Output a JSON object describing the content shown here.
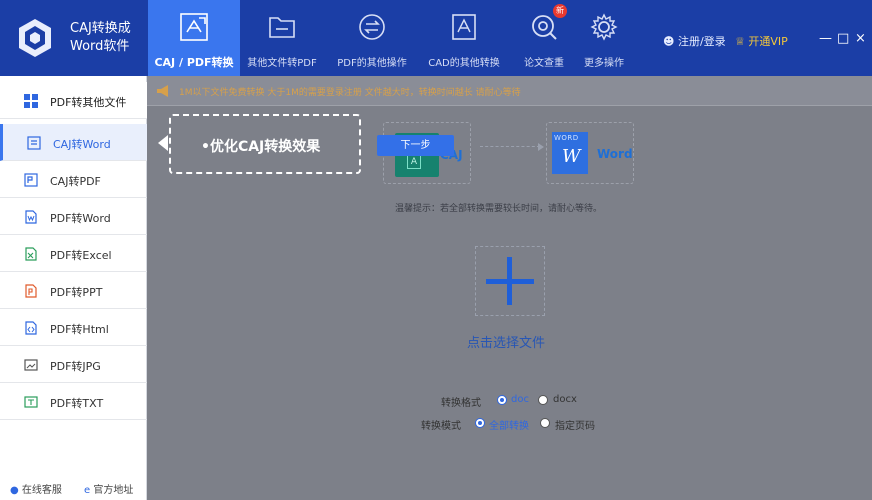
{
  "app": {
    "title_line1": "CAJ转换成",
    "title_line2": "Word软件"
  },
  "tabs": [
    {
      "label": "CAJ / PDF转换",
      "icon": "caj-pdf-convert-icon",
      "active": true
    },
    {
      "label": "其他文件转PDF",
      "icon": "folder-icon"
    },
    {
      "label": "PDF的其他操作",
      "icon": "swap-arrows-icon"
    },
    {
      "label": "CAD的其他转换",
      "icon": "cad-drawing-icon"
    },
    {
      "label": "论文查重",
      "icon": "search-check-icon",
      "badge": "新"
    },
    {
      "label": "更多操作",
      "icon": "gear-icon"
    }
  ],
  "header_right": {
    "login": "注册/登录",
    "vip": "开通VIP"
  },
  "window_controls": {
    "minimize": "—",
    "maximize": "□",
    "close": "×"
  },
  "sidebar": {
    "items": [
      {
        "label": "PDF转其他文件",
        "icon": "grid-icon"
      },
      {
        "label": "CAJ转Word",
        "icon": "caj-word-icon"
      },
      {
        "label": "CAJ转PDF",
        "icon": "caj-pdf-icon"
      },
      {
        "label": "PDF转Word",
        "icon": "pdf-word-icon"
      },
      {
        "label": "PDF转Excel",
        "icon": "pdf-excel-icon"
      },
      {
        "label": "PDF转PPT",
        "icon": "pdf-ppt-icon"
      },
      {
        "label": "PDF转Html",
        "icon": "pdf-html-icon"
      },
      {
        "label": "PDF转JPG",
        "icon": "pdf-jpg-icon"
      },
      {
        "label": "PDF转TXT",
        "icon": "pdf-txt-icon"
      }
    ],
    "support": "在线客服",
    "website": "官方地址"
  },
  "notice": {
    "text": "1M以下文件免费转换    大于1M的需要登录注册    文件越大时，转换时间越长    请耐心等待"
  },
  "tooltip": {
    "text": "•优化CAJ转换效果",
    "next_button": "下一步"
  },
  "conversion": {
    "from_label": "CAJ",
    "from_icon_letter": "A",
    "to_label": "Word",
    "to_icon_top": "WORD",
    "to_icon_letter": "W"
  },
  "hint": "温馨提示：若全部转换需要较长时间，请耐心等待。",
  "upload": {
    "label": "点击选择文件"
  },
  "options": {
    "format_label": "转换格式",
    "format_options": [
      "doc",
      "docx"
    ],
    "format_selected": "doc",
    "mode_label": "转换模式",
    "mode_options": [
      "全部转换",
      "指定页码"
    ],
    "mode_selected": "全部转换"
  },
  "colors": {
    "header_bg": "#1b3ea6",
    "active_tab": "#3a76ee",
    "overlay": "#7d8089",
    "accent": "#2f67e0",
    "vip": "#f3c73a"
  }
}
